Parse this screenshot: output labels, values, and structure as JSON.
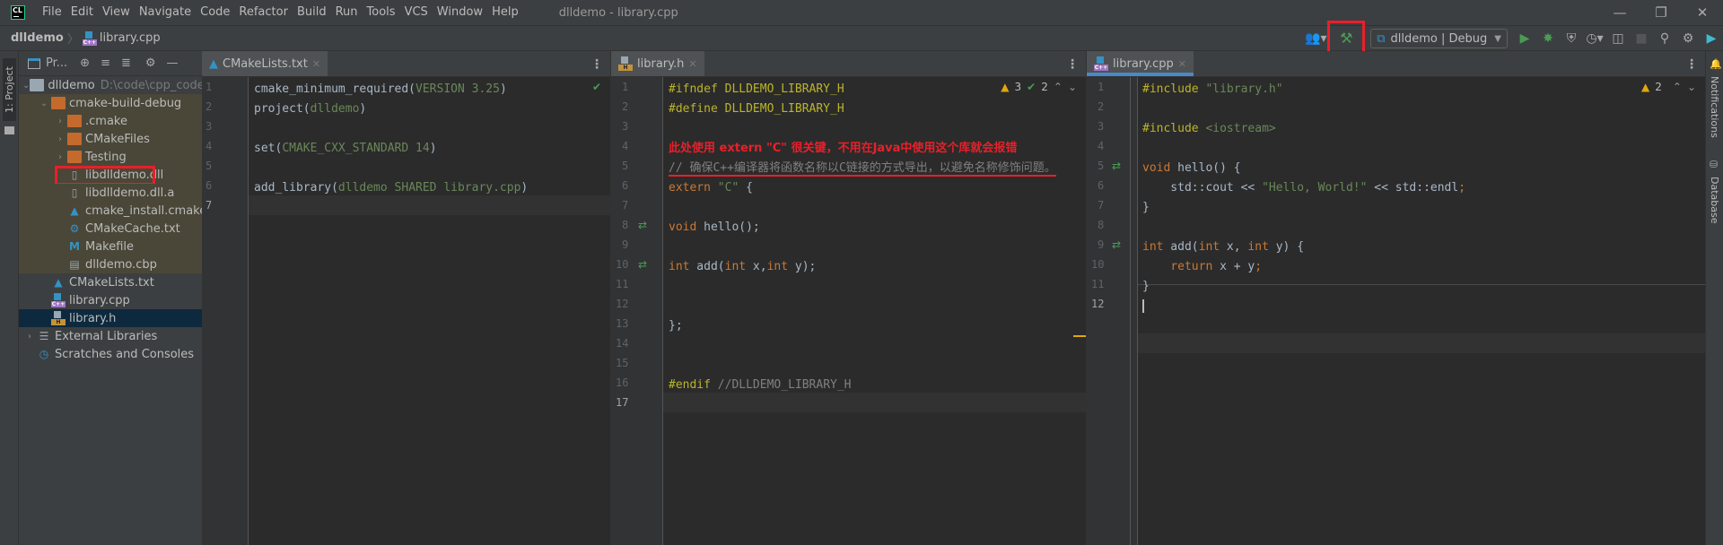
{
  "titlebar": {
    "logo": "CL",
    "menu": [
      "File",
      "Edit",
      "View",
      "Navigate",
      "Code",
      "Refactor",
      "Build",
      "Run",
      "Tools",
      "VCS",
      "Window",
      "Help"
    ],
    "window_title": "dlldemo - library.cpp",
    "controls": [
      "minimize-icon",
      "restore-icon",
      "close-icon"
    ]
  },
  "navbar": {
    "breadcrumb": [
      "dlldemo",
      "library.cpp"
    ],
    "run_config": "dlldemo | Debug",
    "toolbar_icons": [
      "user-icon",
      "build-hammer-icon",
      "run-icon",
      "debug-icon",
      "coverage-icon",
      "profile-icon",
      "attach-icon",
      "stop-icon",
      "search-icon",
      "settings-icon",
      "toolbox-icon"
    ]
  },
  "left_strip": {
    "project_tab": "1: Project"
  },
  "right_strip": {
    "notifications": "Notifications",
    "database": "Database"
  },
  "project_panel": {
    "title": "Pr...",
    "tree": [
      {
        "label": "dlldemo",
        "path": "D:\\code\\cpp_code",
        "type": "folder-root",
        "depth": 0,
        "expanded": true
      },
      {
        "label": "cmake-build-debug",
        "type": "folder",
        "depth": 1,
        "expanded": true
      },
      {
        "label": ".cmake",
        "type": "folder",
        "depth": 2,
        "expanded": false
      },
      {
        "label": "CMakeFiles",
        "type": "folder",
        "depth": 2,
        "expanded": false
      },
      {
        "label": "Testing",
        "type": "folder",
        "depth": 2,
        "expanded": false
      },
      {
        "label": "libdlldemo.dll",
        "type": "unknown-file",
        "depth": 2,
        "highlighted": true
      },
      {
        "label": "libdlldemo.dll.a",
        "type": "unknown-file",
        "depth": 2
      },
      {
        "label": "cmake_install.cmake",
        "type": "cmake",
        "depth": 2
      },
      {
        "label": "CMakeCache.txt",
        "type": "config",
        "depth": 2
      },
      {
        "label": "Makefile",
        "type": "makefile",
        "depth": 2
      },
      {
        "label": "dlldemo.cbp",
        "type": "text",
        "depth": 2
      },
      {
        "label": "CMakeLists.txt",
        "type": "cmake",
        "depth": 1
      },
      {
        "label": "library.cpp",
        "type": "cpp",
        "depth": 1
      },
      {
        "label": "library.h",
        "type": "header",
        "depth": 1,
        "selected": true
      },
      {
        "label": "External Libraries",
        "type": "libraries",
        "depth": 0
      },
      {
        "label": "Scratches and Consoles",
        "type": "scratches",
        "depth": 0
      }
    ]
  },
  "editors": [
    {
      "tab": "CMakeLists.txt",
      "inspection": {
        "status": "ok"
      },
      "current_line": 7,
      "lines": [
        "cmake_minimum_required(VERSION 3.25)",
        "project(dlldemo)",
        "",
        "set(CMAKE_CXX_STANDARD 14)",
        "",
        "add_library(dlldemo SHARED library.cpp)",
        ""
      ]
    },
    {
      "tab": "library.h",
      "inspection": {
        "warnings": "3",
        "weak_warnings": "2"
      },
      "current_line": 17,
      "annotation": "此处使用 extern \"C\" 很关键，不用在Java中使用这个库就会报错",
      "lines": [
        "#ifndef DLLDEMO_LIBRARY_H",
        "#define DLLDEMO_LIBRARY_H",
        "",
        "",
        "// 确保C++编译器将函数名称以C链接的方式导出，以避免名称修饰问题。",
        "extern \"C\" {",
        "",
        "void hello();",
        "",
        "int add(int x,int y);",
        "",
        "",
        "};",
        "",
        "",
        "#endif //DLLDEMO_LIBRARY_H",
        ""
      ]
    },
    {
      "tab": "library.cpp",
      "inspection": {
        "warnings": "2"
      },
      "current_line": 12,
      "lines": [
        "#include \"library.h\"",
        "",
        "#include <iostream>",
        "",
        "void hello() {",
        "    std::cout << \"Hello, World!\" << std::endl;",
        "}",
        "",
        "int add(int x, int y) {",
        "    return x + y;",
        "}",
        ""
      ]
    }
  ]
}
